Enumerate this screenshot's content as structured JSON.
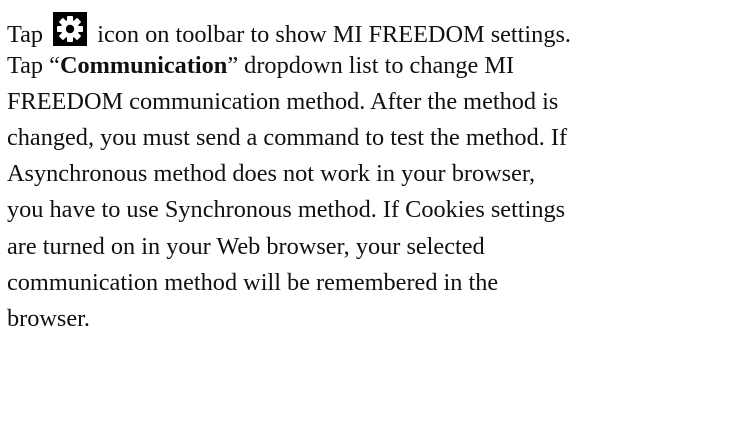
{
  "lines": {
    "l1_before": "Tap",
    "l1_icon": "gear-icon",
    "l1_after": "icon on toolbar to show MI FREEDOM settings.",
    "l2_open": "Tap “",
    "l2_bold": "Communication",
    "l2_close": "” dropdown list to change MI",
    "l3": "FREEDOM communication method. After the method is",
    "l4": "changed, you must send a command to test the method. If",
    "l5": "Asynchronous method does not work in your browser,",
    "l6": "you have to use Synchronous method. If Cookies settings",
    "l7": "are turned on in your Web browser, your selected",
    "l8": "communication method will be remembered in the",
    "l9": "browser."
  },
  "colors": {
    "text": "#111111",
    "icon_background": "#000000",
    "icon_foreground": "#ffffff"
  }
}
